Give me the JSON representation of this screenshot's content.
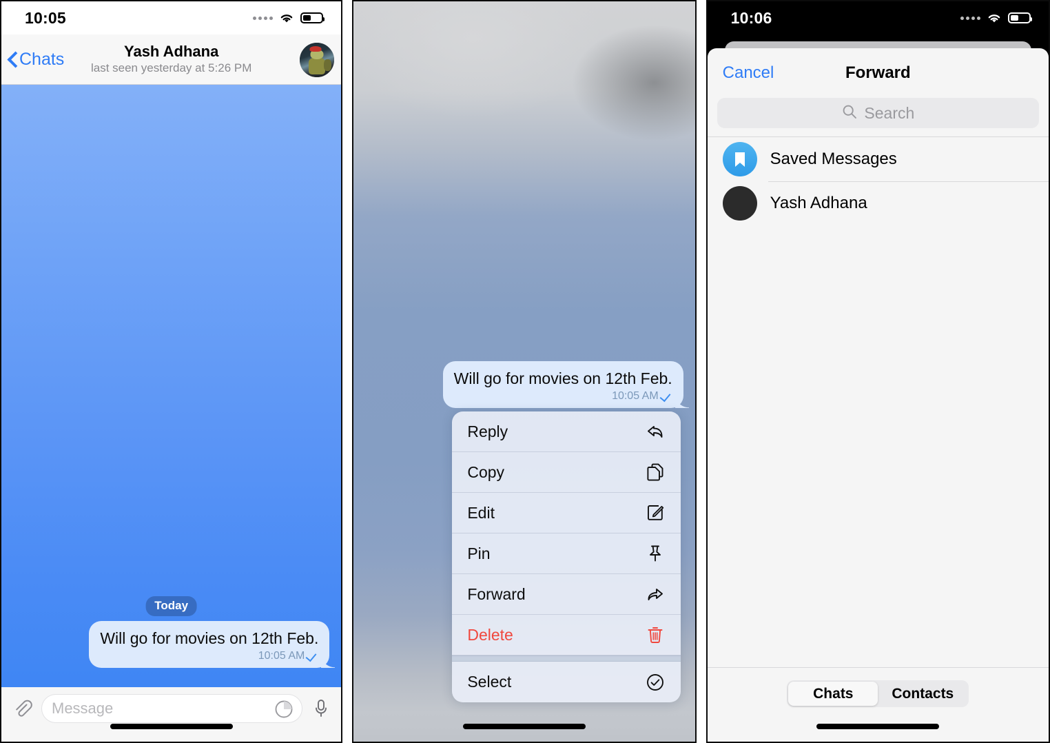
{
  "panels": {
    "one": {
      "status": {
        "time": "10:05"
      },
      "header": {
        "back_label": "Chats",
        "title": "Yash Adhana",
        "subtitle": "last seen yesterday at 5:26 PM"
      },
      "day_separator": "Today",
      "message": {
        "text": "Will go for movies on 12th Feb.",
        "time": "10:05 AM"
      },
      "input": {
        "placeholder": "Message"
      }
    },
    "two": {
      "message": {
        "text": "Will go for movies on 12th Feb.",
        "time": "10:05 AM"
      },
      "menu": [
        {
          "label": "Reply",
          "icon": "reply-icon"
        },
        {
          "label": "Copy",
          "icon": "copy-icon"
        },
        {
          "label": "Edit",
          "icon": "edit-icon"
        },
        {
          "label": "Pin",
          "icon": "pin-icon"
        },
        {
          "label": "Forward",
          "icon": "forward-icon"
        },
        {
          "label": "Delete",
          "icon": "trash-icon"
        },
        {
          "label": "Select",
          "icon": "check-circle-icon"
        }
      ]
    },
    "three": {
      "status": {
        "time": "10:06"
      },
      "header": {
        "cancel_label": "Cancel",
        "title": "Forward"
      },
      "search": {
        "placeholder": "Search"
      },
      "rows": [
        {
          "label": "Saved Messages",
          "kind": "saved"
        },
        {
          "label": "Yash Adhana",
          "kind": "contact"
        }
      ],
      "tabs": [
        {
          "label": "Chats",
          "active": true
        },
        {
          "label": "Contacts",
          "active": false
        }
      ]
    }
  },
  "colors": {
    "accent_blue": "#2f7cf6",
    "bubble_blue": "#ddeafc",
    "danger_red": "#f0483e",
    "saved_icon_blue": "#2e9be8",
    "chat_bg_top": "#83b0f8",
    "chat_bg_bottom": "#3f86f4"
  }
}
